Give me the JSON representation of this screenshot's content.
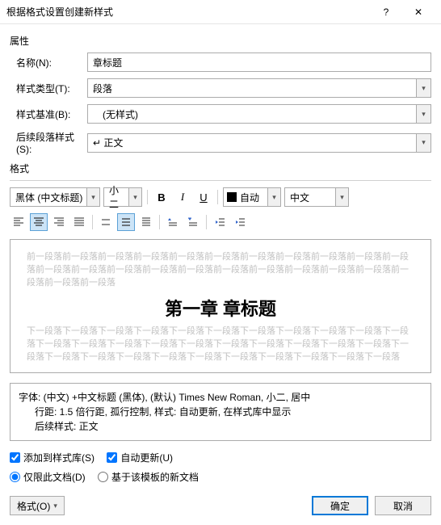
{
  "title": "根据格式设置创建新样式",
  "sections": {
    "props": "属性",
    "format": "格式"
  },
  "labels": {
    "name": "名称(N):",
    "styleType": "样式类型(T):",
    "basedOn": "样式基准(B):",
    "followStyle": "后续段落样式(S):"
  },
  "fields": {
    "name": "章标题",
    "styleType": "段落",
    "basedOn": "(无样式)",
    "followStyle": "↵ 正文"
  },
  "fontToolbar": {
    "font": "黑体 (中文标题)",
    "size": "小二",
    "bold": "B",
    "italic": "I",
    "underline": "U",
    "color": "自动",
    "lang": "中文"
  },
  "preview": {
    "before": "前一段落前一段落前一段落前一段落前一段落前一段落前一段落前一段落前一段落前一段落前一段落前一段落前一段落前一段落前一段落前一段落前一段落前一段落前一段落前一段落前一段落前一段落前一段落前一段落",
    "sample": "第一章 章标题",
    "after": "下一段落下一段落下一段落下一段落下一段落下一段落下一段落下一段落下一段落下一段落下一段落下一段落下一段落下一段落下一段落下一段落下一段落下一段落下一段落下一段落下一段落下一段落下一段落下一段落下一段落下一段落下一段落下一段落下一段落下一段落下一段落下一段落"
  },
  "description": {
    "line1": "字体: (中文) +中文标题 (黑体), (默认) Times New Roman, 小二, 居中",
    "line2": "行距: 1.5 倍行距, 孤行控制, 样式: 自动更新, 在样式库中显示",
    "line3": "后续样式: 正文"
  },
  "checks": {
    "addToGallery": "添加到样式库(S)",
    "autoUpdate": "自动更新(U)"
  },
  "radios": {
    "thisDoc": "仅限此文档(D)",
    "template": "基于该模板的新文档"
  },
  "buttons": {
    "format": "格式(O)",
    "ok": "确定",
    "cancel": "取消"
  }
}
